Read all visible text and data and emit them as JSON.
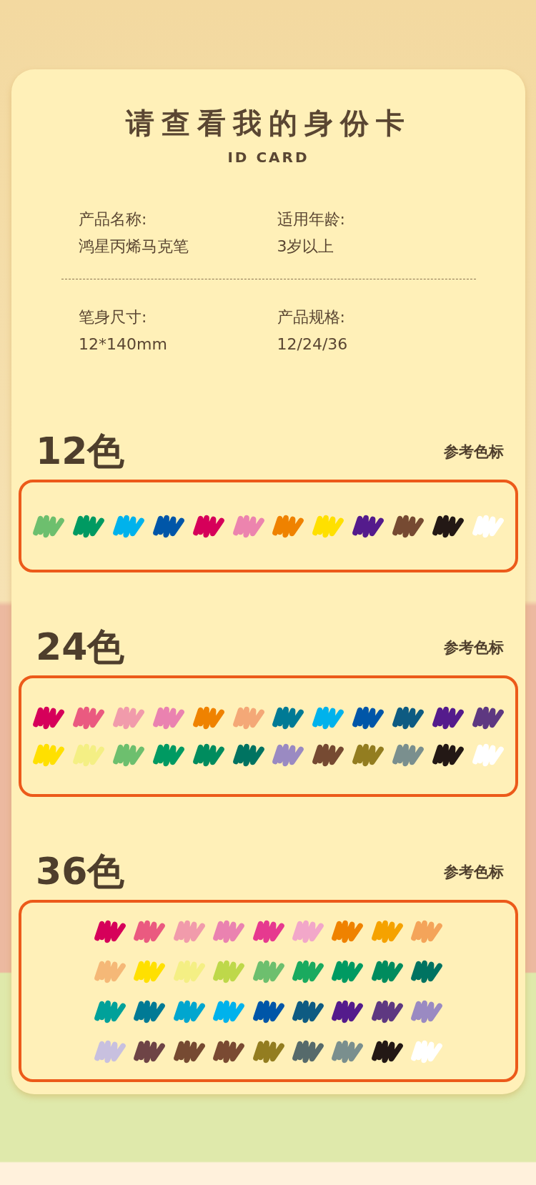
{
  "card": {
    "title": "请查看我的身份卡",
    "subtitle": "ID CARD",
    "field_rows": [
      [
        {
          "label": "产品名称:",
          "value": "鸿星丙烯马克笔"
        },
        {
          "label": "适用年龄:",
          "value": "3岁以上"
        }
      ],
      [
        {
          "label": "笔身尺寸:",
          "value": "12*140mm"
        },
        {
          "label": "产品规格:",
          "value": "12/24/36"
        }
      ]
    ]
  },
  "palettes": [
    {
      "heading": "12色",
      "note": "参考色标",
      "kind": "wide",
      "rows": [
        [
          {
            "color": "#6dbf6e"
          },
          {
            "color": "#009a62"
          },
          {
            "color": "#00b2ec"
          },
          {
            "color": "#0056a8"
          },
          {
            "color": "#d6005a"
          },
          {
            "color": "#ec84ae"
          },
          {
            "color": "#ef8200"
          },
          {
            "color": "#ffe000"
          },
          {
            "color": "#541b8c"
          },
          {
            "color": "#764a32"
          },
          {
            "color": "#231815"
          },
          {
            "color": "#ffffff"
          }
        ]
      ]
    },
    {
      "heading": "24色",
      "note": "参考色标",
      "kind": "wide",
      "rows": [
        [
          {
            "color": "#d6005a"
          },
          {
            "color": "#ea5a80"
          },
          {
            "color": "#f19bab"
          },
          {
            "color": "#ea82b0"
          },
          {
            "color": "#ef8200"
          },
          {
            "color": "#f4a877"
          },
          {
            "color": "#007a95"
          },
          {
            "color": "#00b2ec"
          },
          {
            "color": "#0056a8"
          },
          {
            "color": "#0e5b82"
          },
          {
            "color": "#541b8c"
          },
          {
            "color": "#5e3881"
          }
        ],
        [
          {
            "color": "#ffe000"
          },
          {
            "color": "#f4ef84"
          },
          {
            "color": "#6dbf6e"
          },
          {
            "color": "#009a62"
          },
          {
            "color": "#008c5e"
          },
          {
            "color": "#007361"
          },
          {
            "color": "#9a8ac2"
          },
          {
            "color": "#764a32"
          },
          {
            "color": "#937d20"
          },
          {
            "color": "#7a8f8e"
          },
          {
            "color": "#231815"
          },
          {
            "color": "#ffffff"
          }
        ]
      ]
    },
    {
      "heading": "36色",
      "note": "参考色标",
      "kind": "narrow",
      "rows": [
        [
          {
            "color": "#d6005a"
          },
          {
            "color": "#ea5a80"
          },
          {
            "color": "#f19bab"
          },
          {
            "color": "#ea82b0"
          },
          {
            "color": "#e6398f"
          },
          {
            "color": "#f2a7c9"
          },
          {
            "color": "#ef8200"
          },
          {
            "color": "#f5a200"
          },
          {
            "color": "#f4a45a"
          }
        ],
        [
          {
            "color": "#f5b877"
          },
          {
            "color": "#ffe000"
          },
          {
            "color": "#f4ef84"
          },
          {
            "color": "#bed84a"
          },
          {
            "color": "#6dbf6e"
          },
          {
            "color": "#1aaa5f"
          },
          {
            "color": "#009a62"
          },
          {
            "color": "#008c5e"
          },
          {
            "color": "#007361"
          }
        ],
        [
          {
            "color": "#00a19a"
          },
          {
            "color": "#007a95"
          },
          {
            "color": "#00a6cf"
          },
          {
            "color": "#00b2ec"
          },
          {
            "color": "#0056a8"
          },
          {
            "color": "#0e5b82"
          },
          {
            "color": "#541b8c"
          },
          {
            "color": "#5e3881"
          },
          {
            "color": "#9a8ac2"
          }
        ],
        [
          {
            "color": "#c8c0df"
          },
          {
            "color": "#6e4446"
          },
          {
            "color": "#764a32"
          },
          {
            "color": "#7a4a32"
          },
          {
            "color": "#937d20"
          },
          {
            "color": "#566a6b"
          },
          {
            "color": "#7a8f8e"
          },
          {
            "color": "#231815"
          },
          {
            "color": "#ffffff"
          }
        ]
      ]
    }
  ]
}
